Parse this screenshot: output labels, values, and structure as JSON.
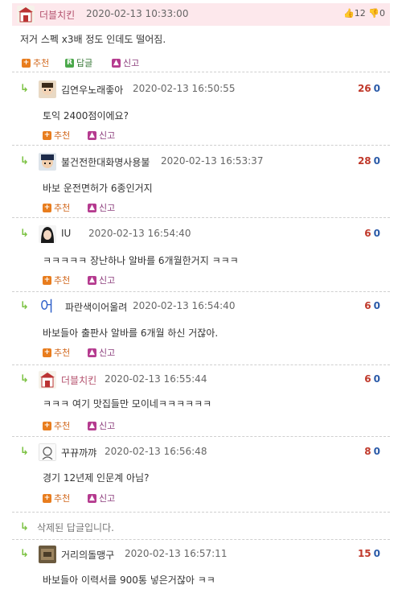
{
  "main_comment": {
    "author": "더블치킨",
    "date": "2020-02-13 10:33:00",
    "upvotes": "12",
    "downvotes": "0",
    "body": "저거 스펙 x3배 정도 인데도 떨어짐.",
    "actions": {
      "recommend": "추천",
      "reply": "답글",
      "report": "신고"
    }
  },
  "replies": [
    {
      "author": "김연우노래좋아",
      "date": "2020-02-13 16:50:55",
      "up": "26",
      "down": "0",
      "body": "토익 2400점이에요?"
    },
    {
      "author": "불건전한대화명사용불",
      "date": "2020-02-13 16:53:37",
      "up": "28",
      "down": "0",
      "body": "바보 운전면허가 6종인거지"
    },
    {
      "author": "IU",
      "date": "2020-02-13 16:54:40",
      "up": "6",
      "down": "0",
      "body": "ㅋㅋㅋㅋㅋ 장난하나 알바를 6개월한거지 ㅋㅋㅋ"
    },
    {
      "author": "파란색이어울려",
      "date": "2020-02-13 16:54:40",
      "up": "6",
      "down": "0",
      "body": "바보들아 출판사 알바를 6개월 하신 거잖아."
    },
    {
      "author": "더블치킨",
      "date": "2020-02-13 16:55:44",
      "up": "6",
      "down": "0",
      "body": "ㅋㅋㅋ 여기 맛집들만 모이네ㅋㅋㅋㅋㅋㅋ"
    },
    {
      "author": "꾸뀨까꺄",
      "date": "2020-02-13 16:56:48",
      "up": "8",
      "down": "0",
      "body": "경기 12년제 인문계 아님?"
    },
    {
      "author": "거리의돌맹구",
      "date": "2020-02-13 16:57:11",
      "up": "15",
      "down": "0",
      "body": "바보들아 이력서를 900통 넣은거잖아 ㅋㅋ"
    }
  ],
  "deleted_reply_text": "삭제된 답글입니다.",
  "reply_actions": {
    "recommend": "추천",
    "report": "신고"
  },
  "icons": {
    "thumb_up": "thumbs-up-icon",
    "thumb_down": "thumbs-down-icon",
    "reply_arrow": "reply-arrow-icon"
  },
  "colors": {
    "header_bg": "#fde8ec",
    "author_main": "#b4526e",
    "upvote": "#c0392b",
    "downvote": "#2a5aa8",
    "reply_arrow": "#7cc243"
  }
}
